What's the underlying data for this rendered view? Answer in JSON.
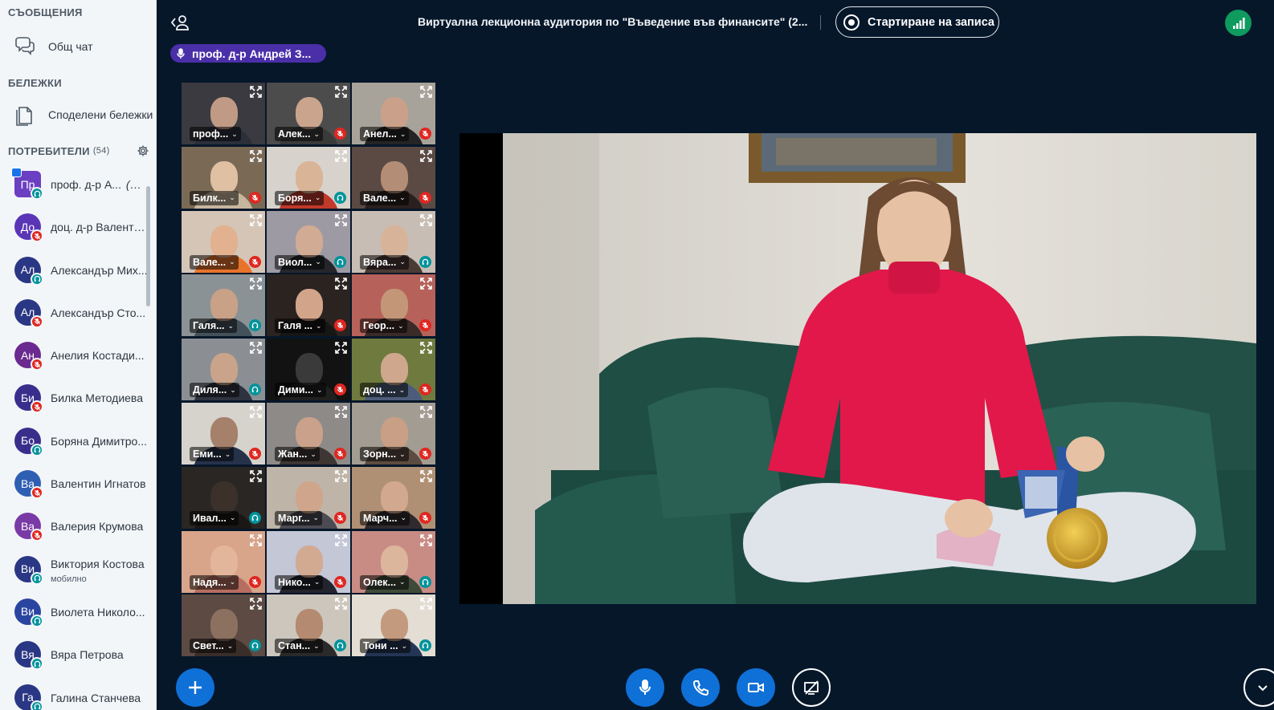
{
  "sidebar": {
    "messages_title": "СЪОБЩЕНИЯ",
    "public_chat": "Общ чат",
    "notes_title": "БЕЛЕЖКИ",
    "shared_notes": "Споделени бележки",
    "users_title": "ПОТРЕБИТЕЛИ",
    "users_count": "(54)",
    "you_suffix": "(Вие)",
    "users": [
      {
        "initials": "Пр",
        "name": "проф. д-р А...",
        "avatar_color": "#6b3fc1",
        "status": "listen",
        "presenter": true,
        "you": true
      },
      {
        "initials": "До",
        "name": "доц. д-р Валенти...",
        "avatar_color": "#5a35b6",
        "status": "muted"
      },
      {
        "initials": "Ал",
        "name": "Александър Мих...",
        "avatar_color": "#2a3784",
        "status": "listen"
      },
      {
        "initials": "Ал",
        "name": "Александър Сто...",
        "avatar_color": "#2a3784",
        "status": "muted"
      },
      {
        "initials": "Ан",
        "name": "Анелия Костади...",
        "avatar_color": "#6b2a8f",
        "status": "muted"
      },
      {
        "initials": "Би",
        "name": "Билка Методиева",
        "avatar_color": "#3a2e8c",
        "status": "muted"
      },
      {
        "initials": "Бо",
        "name": "Боряна Димитро...",
        "avatar_color": "#3a2e8c",
        "status": "listen"
      },
      {
        "initials": "Ва",
        "name": "Валентин Игнатов",
        "avatar_color": "#2f5fb3",
        "status": "muted"
      },
      {
        "initials": "Ва",
        "name": "Валерия Крумова",
        "avatar_color": "#7a3aa6",
        "status": "muted"
      },
      {
        "initials": "Ви",
        "name": "Виктория Костова",
        "sub": "мобилно",
        "avatar_color": "#2a3784",
        "status": "listen"
      },
      {
        "initials": "Ви",
        "name": "Виолета Николо...",
        "avatar_color": "#2a45a0",
        "status": "listen"
      },
      {
        "initials": "Вя",
        "name": "Вяра Петрова",
        "avatar_color": "#2a3784",
        "status": "listen"
      },
      {
        "initials": "Га",
        "name": "Галина Станчева",
        "avatar_color": "#2a3784",
        "status": "listen"
      }
    ]
  },
  "topbar": {
    "title": "Виртуална лекционна аудитория по \"Въведение във финансите\" (2...",
    "record_label": "Стартиране на записа",
    "talking": "проф. д-р Андрей З..."
  },
  "tiles": [
    {
      "label": "проф...",
      "status": "none",
      "bg": "#3b3a40",
      "skin": "#c09a85",
      "shirt": "#2b2f3a",
      "active": true
    },
    {
      "label": "Алек...",
      "status": "muted",
      "bg": "#4c4c4c",
      "skin": "#caa48c",
      "shirt": "#3a3a3a"
    },
    {
      "label": "Анел...",
      "status": "muted",
      "bg": "#a8a39a",
      "skin": "#caa08a",
      "shirt": "#242424"
    },
    {
      "label": "Билк...",
      "status": "muted",
      "bg": "#7a6a55",
      "skin": "#e0c0a3",
      "shirt": "#c7b59e"
    },
    {
      "label": "Боря...",
      "status": "listen",
      "bg": "#d8d2cc",
      "skin": "#d9b496",
      "shirt": "#c0392b"
    },
    {
      "label": "Вале...",
      "status": "muted",
      "bg": "#5b4a44",
      "skin": "#b48d76",
      "shirt": "#2a2020"
    },
    {
      "label": "Вале...",
      "status": "muted",
      "bg": "#d4c5b7",
      "skin": "#e2b18f",
      "shirt": "#e8742c"
    },
    {
      "label": "Виол...",
      "status": "listen",
      "bg": "#9d9aa3",
      "skin": "#d2ab94",
      "shirt": "#25262b"
    },
    {
      "label": "Вяра...",
      "status": "listen",
      "bg": "#c8bdb4",
      "skin": "#d7b39a",
      "shirt": "#4a3b35"
    },
    {
      "label": "Галя...",
      "status": "listen",
      "bg": "#8b9296",
      "skin": "#c9a187",
      "shirt": "#43515a"
    },
    {
      "label": "Галя ...",
      "status": "muted",
      "bg": "#2b2320",
      "skin": "#d2a58a",
      "shirt": "#161616"
    },
    {
      "label": "Геор...",
      "status": "muted",
      "bg": "#b6625a",
      "skin": "#c39678",
      "shirt": "#3a2a28"
    },
    {
      "label": "Диля...",
      "status": "listen",
      "bg": "#8b8f94",
      "skin": "#c9a48a",
      "shirt": "#2f3340"
    },
    {
      "label": "Дими...",
      "status": "muted",
      "bg": "#121212",
      "skin": "#3a3a3a",
      "shirt": "#202020"
    },
    {
      "label": "доц. ...",
      "status": "muted",
      "bg": "#6f7a3f",
      "skin": "#cfa78d",
      "shirt": "#4d5c7a"
    },
    {
      "label": "Еми...",
      "status": "muted",
      "bg": "#d6d3cc",
      "skin": "#a5806a",
      "shirt": "#26324a"
    },
    {
      "label": "Жан...",
      "status": "muted",
      "bg": "#8d8a88",
      "skin": "#caa18a",
      "shirt": "#3d3633"
    },
    {
      "label": "Зорн...",
      "status": "muted",
      "bg": "#a39c92",
      "skin": "#c99f86",
      "shirt": "#5c4b40"
    },
    {
      "label": "Ивал...",
      "status": "listen",
      "bg": "#2a2623",
      "skin": "#3b302a",
      "shirt": "#1a1715"
    },
    {
      "label": "Марг...",
      "status": "muted",
      "bg": "#bfb4a8",
      "skin": "#cfa58c",
      "shirt": "#4c4a52"
    },
    {
      "label": "Марч...",
      "status": "muted",
      "bg": "#b09074",
      "skin": "#d2a98f",
      "shirt": "#2f2a2e"
    },
    {
      "label": "Надя...",
      "status": "muted",
      "bg": "#d8a48a",
      "skin": "#e3b59a",
      "shirt": "#b76d5f"
    },
    {
      "label": "Нико...",
      "status": "muted",
      "bg": "#c3c7d6",
      "skin": "#d2aa92",
      "shirt": "#22242e"
    },
    {
      "label": "Олек...",
      "status": "listen",
      "bg": "#c88c84",
      "skin": "#dcb59d",
      "shirt": "#3f4a3a"
    },
    {
      "label": "Свет...",
      "status": "listen",
      "bg": "#5c4a43",
      "skin": "#8c7060",
      "shirt": "#3a2e29"
    },
    {
      "label": "Стан...",
      "status": "listen",
      "bg": "#cdc6bd",
      "skin": "#b48a70",
      "shirt": "#2a2a2a"
    },
    {
      "label": "Тони ...",
      "status": "listen",
      "bg": "#e3ddd3",
      "skin": "#c49a7e",
      "shirt": "#243556"
    }
  ],
  "colors": {
    "background": "#06172a",
    "sidebar": "#f3f6f9",
    "accent_blue": "#0f70d7",
    "talking_purple": "#4a2fa9",
    "muted_red": "#df2721",
    "listen_teal": "#00939b",
    "connection_green": "#0f9a5e"
  },
  "controls": {
    "add": "plus-icon",
    "mic": "microphone-icon",
    "phone": "phone-icon",
    "camera": "video-camera-icon",
    "screenshare": "screenshare-off-icon"
  }
}
